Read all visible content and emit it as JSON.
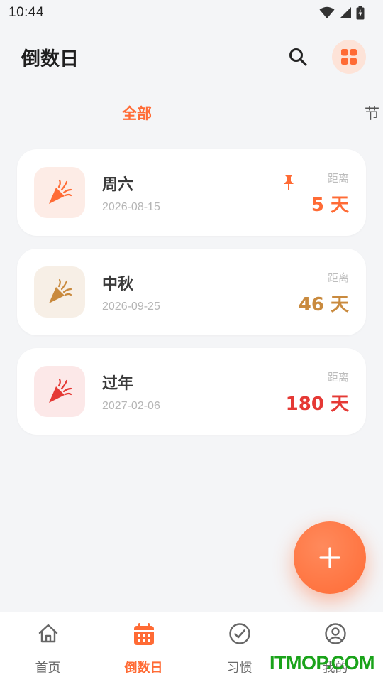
{
  "status_bar": {
    "time": "10:44"
  },
  "header": {
    "title": "倒数日"
  },
  "tabs": [
    {
      "label": "全部",
      "active": true
    },
    {
      "label": "节",
      "active": false
    }
  ],
  "cards": [
    {
      "name": "周六",
      "date": "2026-08-15",
      "distance_label": "距离",
      "days": "5 天",
      "accent": "#ff6b35",
      "icon_bg": "#fdece6",
      "pinned": true
    },
    {
      "name": "中秋",
      "date": "2026-09-25",
      "distance_label": "距离",
      "days": "46 天",
      "accent": "#c98a3e",
      "icon_bg": "#f7efe6",
      "pinned": false
    },
    {
      "name": "过年",
      "date": "2027-02-06",
      "distance_label": "距离",
      "days": "180 天",
      "accent": "#e53935",
      "icon_bg": "#fce8e8",
      "pinned": false
    }
  ],
  "bottom_nav": [
    {
      "label": "首页",
      "icon": "home-icon",
      "active": false
    },
    {
      "label": "倒数日",
      "icon": "calendar-icon",
      "active": true
    },
    {
      "label": "习惯",
      "icon": "check-circle-icon",
      "active": false
    },
    {
      "label": "我的",
      "icon": "user-circle-icon",
      "active": false
    }
  ],
  "colors": {
    "accent": "#ff6b35",
    "background": "#f4f5f7"
  },
  "watermark": "ITMOP.COM"
}
